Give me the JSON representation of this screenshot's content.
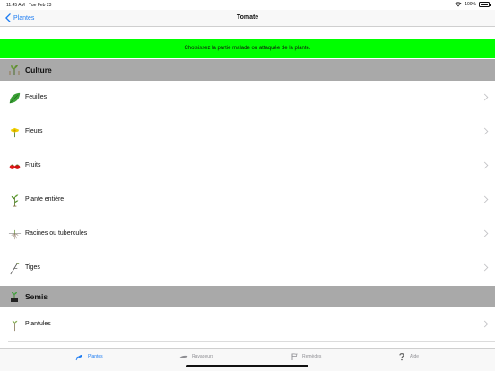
{
  "status": {
    "time": "11:45 AM",
    "date": "Tue Feb 23",
    "battery": "100%"
  },
  "nav": {
    "back_label": "Plantes",
    "title": "Tomate"
  },
  "banner": {
    "text": "Choisissez la partie malade ou attaquée de la plante.",
    "color": "#00ff00"
  },
  "sections": [
    {
      "title": "Culture",
      "icon": "plant-seedling-icon",
      "items": [
        {
          "label": "Feuilles",
          "icon": "leaf-icon"
        },
        {
          "label": "Fleurs",
          "icon": "flower-icon"
        },
        {
          "label": "Fruits",
          "icon": "tomato-fruit-icon"
        },
        {
          "label": "Plante entière",
          "icon": "whole-plant-icon"
        },
        {
          "label": "Racines ou tubercules",
          "icon": "roots-icon"
        },
        {
          "label": "Tiges",
          "icon": "stem-icon"
        }
      ]
    },
    {
      "title": "Semis",
      "icon": "seedling-pot-icon",
      "items": [
        {
          "label": "Plantules",
          "icon": "sprout-icon"
        }
      ]
    }
  ],
  "tabs": [
    {
      "label": "Plantes",
      "icon": "plants-tab-icon",
      "active": true
    },
    {
      "label": "Ravageurs",
      "icon": "pests-tab-icon",
      "active": false
    },
    {
      "label": "Remèdes",
      "icon": "remedies-tab-icon",
      "active": false
    },
    {
      "label": "Aide",
      "icon": "help-tab-icon",
      "active": false
    }
  ],
  "colors": {
    "accent": "#1d7cf2",
    "section_bg": "#a9a9a9",
    "tab_inactive": "#8e8e93"
  }
}
